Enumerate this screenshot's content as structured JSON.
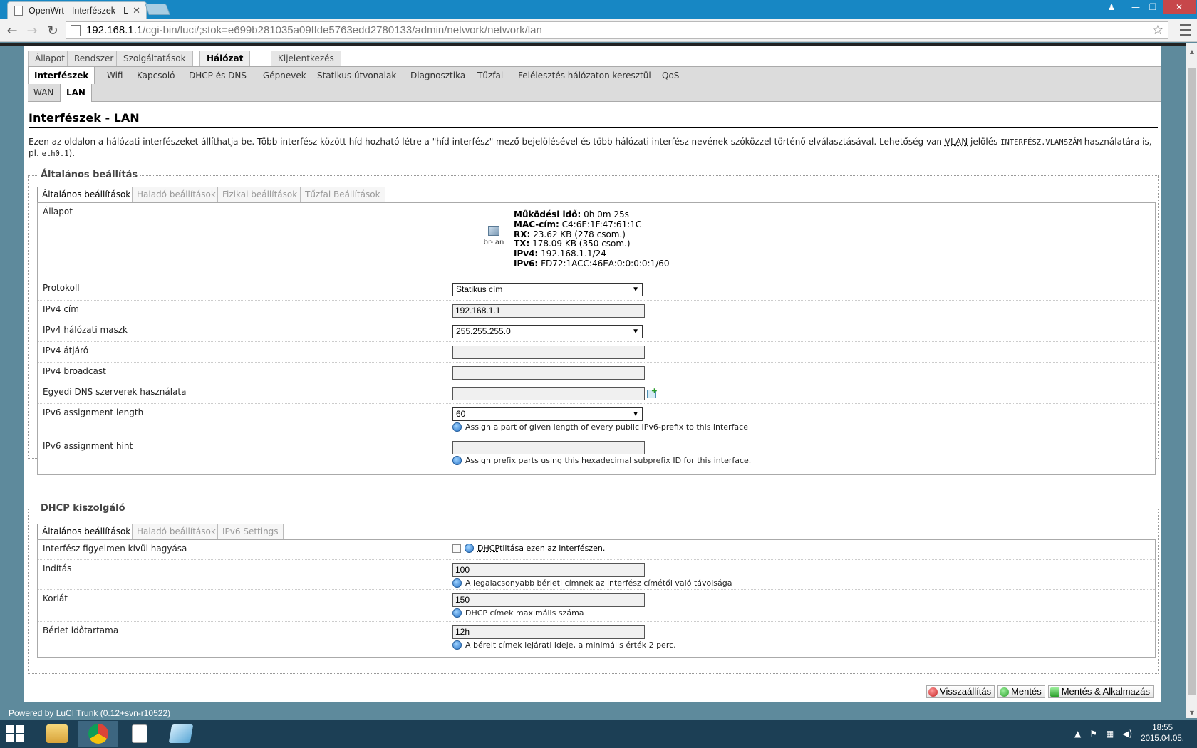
{
  "browser": {
    "tab_title": "OpenWrt - Interfészek - Lu",
    "url_host": "192.168.1.1",
    "url_path": "/cgi-bin/luci/;stok=e699b281035a09ffde5763edd2780133/admin/network/network/lan"
  },
  "menu": {
    "top": [
      "Állapot",
      "Rendszer",
      "Szolgáltatások",
      "Hálózat",
      "Kijelentkezés"
    ],
    "sub": [
      "Interfészek",
      "Wifi",
      "Kapcsoló",
      "DHCP és DNS",
      "Gépnevek",
      "Statikus útvonalak",
      "Diagnosztika",
      "Tűzfal",
      "Felélesztés hálózaton keresztül",
      "QoS"
    ],
    "sub2": [
      "WAN",
      "LAN"
    ]
  },
  "page": {
    "title": "Interfészek - LAN",
    "desc_1": "Ezen az oldalon a hálózati interfészeket állíthatja be. Több interfész között híd hozható létre a \"híd interfész\" mező bejelölésével és több hálózati interfész nevének szóközzel történő elválasztásával. Lehetőség van ",
    "desc_vlan": "VLAN",
    "desc_2": " jelölés ",
    "desc_code": "INTERFÉSZ.VLANSZÁM",
    "desc_3": " használatára is, pl. ",
    "desc_example": "eth0.1",
    "desc_4": ")."
  },
  "general": {
    "legend": "Általános beállítás",
    "tabs": [
      "Általános beállítások",
      "Haladó beállítások",
      "Fizikai beállítások",
      "Tűzfal Beállítások"
    ],
    "status_label": "Állapot",
    "iface_name": "br-lan",
    "status": {
      "uptime_k": "Működési idő:",
      "uptime_v": "0h 0m 25s",
      "mac_k": "MAC-cím:",
      "mac_v": "C4:6E:1F:47:61:1C",
      "rx_k": "RX:",
      "rx_v": "23.62 KB (278 csom.)",
      "tx_k": "TX:",
      "tx_v": "178.09 KB (350 csom.)",
      "ipv4_k": "IPv4:",
      "ipv4_v": "192.168.1.1/24",
      "ipv6_k": "IPv6:",
      "ipv6_v": "FD72:1ACC:46EA:0:0:0:0:1/60"
    },
    "protocol_label": "Protokoll",
    "protocol_value": "Statikus cím",
    "ipv4_addr_label": "IPv4 cím",
    "ipv4_addr_value": "192.168.1.1",
    "netmask_label": "IPv4 hálózati maszk",
    "netmask_value": "255.255.255.0",
    "gateway_label": "IPv4 átjáró",
    "gateway_value": "",
    "broadcast_label": "IPv4 broadcast",
    "broadcast_value": "",
    "dns_label": "Egyedi DNS szerverek használata",
    "dns_value": "",
    "ip6len_label": "IPv6 assignment length",
    "ip6len_value": "60",
    "ip6len_hint": "Assign a part of given length of every public IPv6-prefix to this interface",
    "ip6hint_label": "IPv6 assignment hint",
    "ip6hint_value": "",
    "ip6hint_hint": "Assign prefix parts using this hexadecimal subprefix ID for this interface."
  },
  "dhcp": {
    "legend": "DHCP kiszolgáló",
    "tabs": [
      "Általános beállítások",
      "Haladó beállítások",
      "IPv6 Settings"
    ],
    "ignore_label": "Interfész figyelmen kívül hagyása",
    "ignore_hint_abbr": "DHCP",
    "ignore_hint": " tiltása ezen az interfészen.",
    "start_label": "Indítás",
    "start_value": "100",
    "start_hint": "A legalacsonyabb bérleti címnek az interfész címétől való távolsága",
    "limit_label": "Korlát",
    "limit_value": "150",
    "limit_hint": "DHCP címek maximális száma",
    "lease_label": "Bérlet időtartama",
    "lease_value": "12h",
    "lease_hint": "A bérelt címek lejárati ideje, a minimális érték 2 perc."
  },
  "buttons": {
    "reset": "Visszaállítás",
    "save": "Mentés",
    "apply": "Mentés & Alkalmazás"
  },
  "footer": "Powered by LuCI Trunk (0.12+svn-r10522)",
  "taskbar": {
    "time": "18:55",
    "date": "2015.04.05."
  }
}
